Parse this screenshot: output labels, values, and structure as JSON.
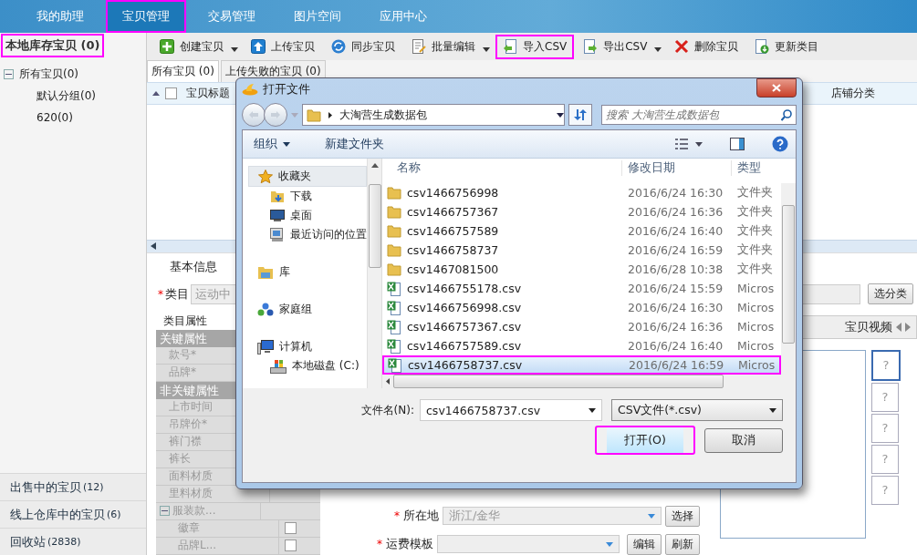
{
  "nav": [
    {
      "label": "我的助理",
      "selected": false,
      "highlighted": false
    },
    {
      "label": "宝贝管理",
      "selected": true,
      "highlighted": true
    },
    {
      "label": "交易管理",
      "selected": false,
      "highlighted": false
    },
    {
      "label": "图片空间",
      "selected": false,
      "highlighted": false
    },
    {
      "label": "应用中心",
      "selected": false,
      "highlighted": false
    }
  ],
  "sidebar": {
    "title": "本地库存宝贝 (0)",
    "highlighted": true,
    "tree": [
      {
        "label": "所有宝贝(0)",
        "expanded": true,
        "children": [
          {
            "label": "默认分组(0)"
          },
          {
            "label": "620(0)"
          }
        ]
      }
    ],
    "sections": [
      {
        "label": "出售中的宝贝",
        "count": "(12)"
      },
      {
        "label": "线上仓库中的宝贝",
        "count": "(6)"
      },
      {
        "label": "回收站",
        "count": "(2838)"
      }
    ]
  },
  "toolbar": [
    {
      "label": "创建宝贝",
      "has_menu": true,
      "highlighted": false
    },
    {
      "label": "上传宝贝",
      "has_menu": false,
      "highlighted": false
    },
    {
      "label": "同步宝贝",
      "has_menu": false,
      "highlighted": false
    },
    {
      "label": "批量编辑",
      "has_menu": true,
      "highlighted": false
    },
    {
      "label": "导入CSV",
      "has_menu": false,
      "highlighted": true
    },
    {
      "label": "导出CSV",
      "has_menu": true,
      "highlighted": false
    },
    {
      "label": "删除宝贝",
      "has_menu": false,
      "highlighted": false
    },
    {
      "label": "更新类目",
      "has_menu": false,
      "highlighted": false
    }
  ],
  "tabs": [
    {
      "label": "所有宝贝 (0)",
      "selected": true
    },
    {
      "label": "上传失败的宝贝 (0)",
      "selected": false
    }
  ],
  "table": {
    "columns": [
      "宝贝标题",
      "店铺分类"
    ],
    "all_checked": false
  },
  "form": {
    "tab": "基本信息",
    "category": {
      "mark": "*",
      "label": "类目",
      "value": "运动中"
    },
    "category_button": "选分类",
    "attributes": {
      "title": "类目属性",
      "groups": [
        {
          "label": "关键属性",
          "rows": [
            {
              "label": "款号*",
              "kind": "text"
            },
            {
              "label": "品牌*",
              "kind": "text"
            }
          ]
        },
        {
          "label": "非关键属性",
          "rows": [
            {
              "label": "上市时间",
              "kind": "text"
            },
            {
              "label": "吊牌价*",
              "kind": "text"
            },
            {
              "label": "裤门襟",
              "kind": "text"
            },
            {
              "label": "裤长",
              "kind": "text"
            },
            {
              "label": "面料材质",
              "kind": "text"
            },
            {
              "label": "里料材质",
              "kind": "text"
            },
            {
              "label": "服装款...",
              "kind": "group",
              "expanded": true,
              "children": [
                {
                  "label": "徽章",
                  "kind": "checkbox",
                  "checked": false
                },
                {
                  "label": "品牌L...",
                  "kind": "checkbox",
                  "checked": false
                }
              ]
            }
          ]
        }
      ]
    },
    "location": {
      "mark": "*",
      "label": "所在地",
      "value": "浙江/金华",
      "button": "选择"
    },
    "shipping": {
      "mark": "*",
      "label": "运费模板",
      "buttons": [
        "编辑",
        "刷新"
      ]
    },
    "media": {
      "tab": "宝贝视频",
      "slots": [
        {
          "label": "?",
          "selected": true
        },
        {
          "label": "?",
          "selected": false
        },
        {
          "label": "?",
          "selected": false
        },
        {
          "label": "?",
          "selected": false
        },
        {
          "label": "?",
          "selected": false
        }
      ]
    }
  },
  "dialog": {
    "title": "打开文件",
    "path": "大淘营生成数据包",
    "search_placeholder": "搜索 大淘营生成数据包",
    "commands": [
      "组织",
      "新建文件夹"
    ],
    "places": [
      {
        "label": "收藏夹",
        "selected": true,
        "children": [
          {
            "label": "下载",
            "selected": false
          },
          {
            "label": "桌面",
            "selected": false
          },
          {
            "label": "最近访问的位置",
            "selected": false
          }
        ]
      },
      {
        "label": "库",
        "selected": false
      },
      {
        "label": "家庭组",
        "selected": false
      },
      {
        "label": "计算机",
        "selected": false,
        "children": [
          {
            "label": "本地磁盘 (C:)",
            "selected": false
          }
        ]
      }
    ],
    "columns": [
      "名称",
      "修改日期",
      "类型"
    ],
    "files": [
      {
        "name": "csv1466756998",
        "date": "2016/6/24 16:30",
        "type": "文件夹",
        "kind": "folder",
        "selected": false,
        "highlighted": false
      },
      {
        "name": "csv1466757367",
        "date": "2016/6/24 16:36",
        "type": "文件夹",
        "kind": "folder",
        "selected": false,
        "highlighted": false
      },
      {
        "name": "csv1466757589",
        "date": "2016/6/24 16:40",
        "type": "文件夹",
        "kind": "folder",
        "selected": false,
        "highlighted": false
      },
      {
        "name": "csv1466758737",
        "date": "2016/6/24 16:59",
        "type": "文件夹",
        "kind": "folder",
        "selected": false,
        "highlighted": false
      },
      {
        "name": "csv1467081500",
        "date": "2016/6/28 10:38",
        "type": "文件夹",
        "kind": "folder",
        "selected": false,
        "highlighted": false
      },
      {
        "name": "csv1466755178.csv",
        "date": "2016/6/24 15:59",
        "type": "Micros",
        "kind": "csv",
        "selected": false,
        "highlighted": false
      },
      {
        "name": "csv1466756998.csv",
        "date": "2016/6/24 16:30",
        "type": "Micros",
        "kind": "csv",
        "selected": false,
        "highlighted": false
      },
      {
        "name": "csv1466757367.csv",
        "date": "2016/6/24 16:36",
        "type": "Micros",
        "kind": "csv",
        "selected": false,
        "highlighted": false
      },
      {
        "name": "csv1466757589.csv",
        "date": "2016/6/24 16:40",
        "type": "Micros",
        "kind": "csv",
        "selected": false,
        "highlighted": false
      },
      {
        "name": "csv1466758737.csv",
        "date": "2016/6/24 16:59",
        "type": "Micros",
        "kind": "csv",
        "selected": true,
        "highlighted": true
      }
    ],
    "filename_label": "文件名(N):",
    "filename": "csv1466758737.csv",
    "filter": "CSV文件(*.csv)",
    "buttons": [
      {
        "label": "打开(O)",
        "highlighted": true
      },
      {
        "label": "取消",
        "highlighted": false
      }
    ]
  }
}
